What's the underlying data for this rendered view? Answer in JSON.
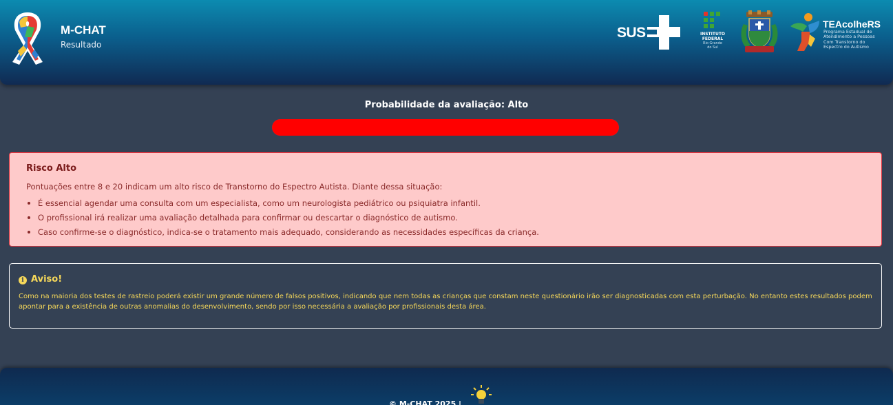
{
  "header": {
    "app_title": "M-CHAT",
    "app_subtitle": "Resultado",
    "partners": {
      "sus": {
        "text": "SUS",
        "icon": "sus-cross-icon"
      },
      "instituto_federal": {
        "line1": "INSTITUTO",
        "line2": "FEDERAL",
        "line3": "Rio Grande",
        "line4": "do Sul"
      },
      "crest": {
        "icon": "municipal-crest-icon"
      },
      "teacolhers": {
        "title": "TEAcolheRS",
        "subtitle_lines": [
          "Programa Estadual de",
          "Atendimento a Pessoas",
          "Com Transtorno do",
          "Espectro do Autismo"
        ]
      }
    }
  },
  "probability": {
    "label": "Probabilidade da avaliação: Alto",
    "level_fraction": 1.0,
    "fill_color": "#ff0000"
  },
  "risk": {
    "title": "Risco Alto",
    "intro": "Pontuações entre 8 e 20 indicam um alto risco de Transtorno do Espectro Autista. Diante dessa situação:",
    "items": [
      "É essencial agendar uma consulta com um especialista, como um neurologista pediátrico ou psiquiatra infantil.",
      "O profissional irá realizar uma avaliação detalhada para confirmar ou descartar o diagnóstico de autismo.",
      "Caso confirme-se o diagnóstico, indica-se o tratamento mais adequado, considerando as necessidades específicas da criança."
    ],
    "colors": {
      "background": "#fecaca",
      "border": "#e0343f"
    }
  },
  "warning": {
    "icon": "info-icon",
    "title": "Aviso!",
    "text": "Como na maioria dos testes de rastreio poderá existir um grande número de falsos positivos, indicando que nem todas as crianças que constam neste questionário irão ser diagnosticadas com esta perturbação. No entanto estes resultados podem apontar para a existência de outras anomalias do desenvolvimento, sendo por isso necessária a avaliação por profissionais desta área.",
    "color": "#f6d85a"
  },
  "footer": {
    "text": "© M-CHAT 2025 |",
    "icon": "lightbulb-icon"
  }
}
